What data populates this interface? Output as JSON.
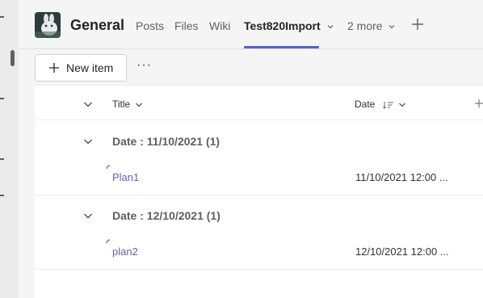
{
  "header": {
    "channel_name": "General",
    "tabs": [
      {
        "label": "Posts"
      },
      {
        "label": "Files"
      },
      {
        "label": "Wiki"
      },
      {
        "label": "Test820Import",
        "active": true
      },
      {
        "label": "2 more"
      }
    ]
  },
  "toolbar": {
    "new_item_label": "New item",
    "more_label": "···"
  },
  "columns": {
    "title": "Title",
    "date": "Date"
  },
  "groups": [
    {
      "label": "Date : 11/10/2021 (1)",
      "rows": [
        {
          "title": "Plan1",
          "date": "11/10/2021 12:00 ..."
        }
      ]
    },
    {
      "label": "Date : 12/10/2021 (1)",
      "rows": [
        {
          "title": "plan2",
          "date": "12/10/2021 12:00 ..."
        }
      ]
    }
  ],
  "icons": [
    "channel-avatar",
    "chevron-down-icon",
    "plus-icon",
    "sort-icon",
    "loading-spinner-icon"
  ],
  "colors": {
    "accent": "#5b5fc7",
    "link": "#6264a7",
    "background": "#f5f5f5"
  }
}
